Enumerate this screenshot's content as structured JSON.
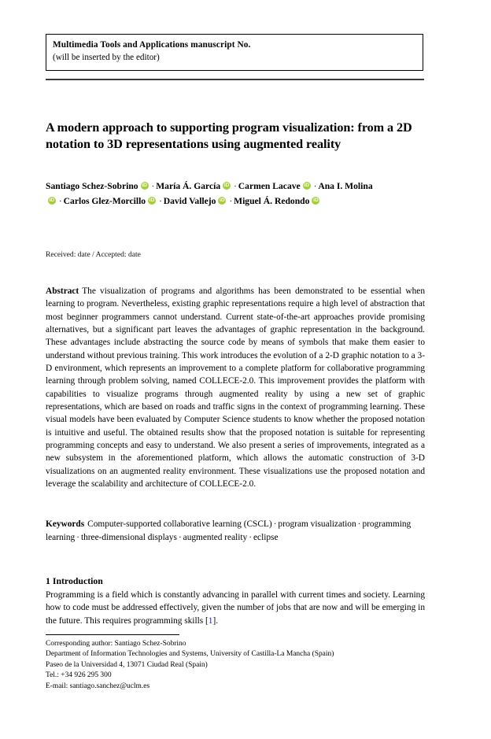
{
  "journal_header": {
    "title": "Multimedia Tools and Applications manuscript No.",
    "subtitle": "(will be inserted by the editor)"
  },
  "paper": {
    "title": "A modern approach to supporting program visualization: from a 2D notation to 3D representations using augmented reality",
    "received_line": "Received: date / Accepted: date"
  },
  "authors": {
    "orcid_badge_label": "iD",
    "orcid_badge_color": "#a6ce39",
    "separator": "·",
    "list": [
      {
        "name": "Santiago Schez-Sobrino",
        "orcid": true
      },
      {
        "name": "María Á. García",
        "orcid": true
      },
      {
        "name": "Carmen Lacave",
        "orcid": true
      },
      {
        "name": "Ana I. Molina",
        "orcid": true
      },
      {
        "name": "Carlos Glez-Morcillo",
        "orcid": true
      },
      {
        "name": "David Vallejo",
        "orcid": true
      },
      {
        "name": "Miguel Á. Redondo",
        "orcid": true
      }
    ]
  },
  "abstract": {
    "label": "Abstract",
    "text": "The visualization of programs and algorithms has been demonstrated to be essential when learning to program. Nevertheless, existing graphic representations require a high level of abstraction that most beginner programmers cannot understand. Current state-of-the-art approaches provide promising alternatives, but a significant part leaves the advantages of graphic representation in the background. These advantages include abstracting the source code by means of symbols that make them easier to understand without previous training. This work introduces the evolution of a 2-D graphic notation to a 3-D environment, which represents an improvement to a complete platform for collaborative programming learning through problem solving, named COLLECE-2.0. This improvement provides the platform with capabilities to visualize programs through augmented reality by using a new set of graphic representations, which are based on roads and traffic signs in the context of programming learning. These visual models have been evaluated by Computer Science students to know whether the proposed notation is intuitive and useful. The obtained results show that the proposed notation is suitable for representing programming concepts and easy to understand. We also present a series of improvements, integrated as a new subsystem in the aforementioned platform, which allows the automatic construction of 3-D visualizations on an augmented reality environment. These visualizations use the proposed notation and leverage the scalability and architecture of COLLECE-2.0."
  },
  "keywords": {
    "label": "Keywords",
    "separator": "·",
    "items": [
      "Computer-supported collaborative learning (CSCL)",
      "program visualization",
      "programming learning",
      "three-dimensional displays",
      "augmented reality",
      "eclipse"
    ]
  },
  "introduction": {
    "heading": "1 Introduction",
    "paragraph_before_citation": "Programming is a field which is constantly advancing in parallel with current times and society. Learning how to code must be addressed effectively, given the number of jobs that are now and will be emerging in the future. This requires programming skills [",
    "citation": "1",
    "paragraph_after_citation": "]."
  },
  "footnote": {
    "lines": [
      "Corresponding author: Santiago Schez-Sobrino",
      "Department of Information Technologies and Systems, University of Castilla-La Mancha (Spain)",
      "Paseo de la Universidad 4, 13071 Ciudad Real (Spain)",
      "Tel.: +34 926 295 300",
      "E-mail: santiago.sanchez@uclm.es"
    ]
  }
}
